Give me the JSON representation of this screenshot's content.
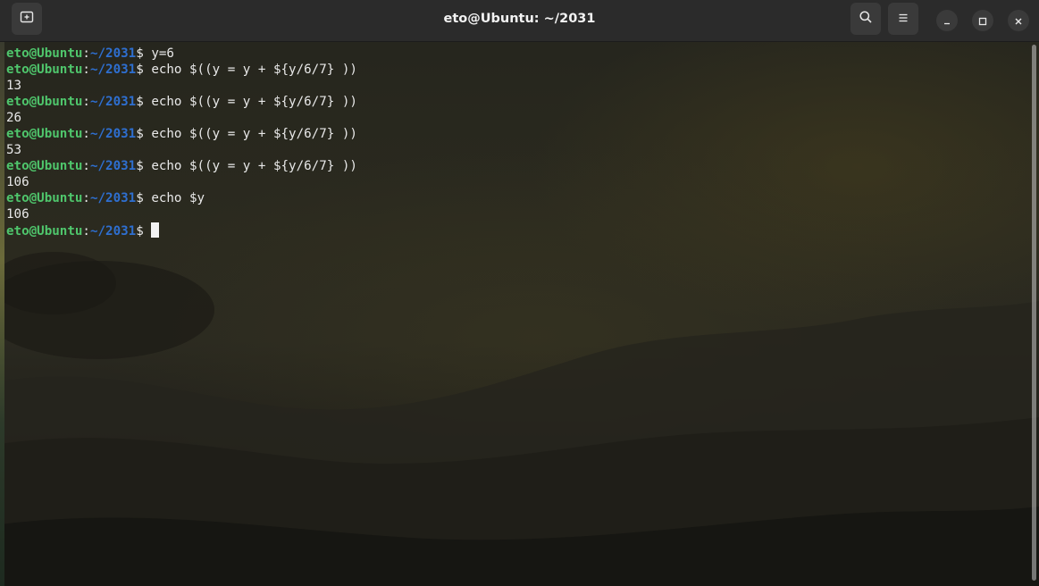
{
  "window": {
    "title": "eto@Ubuntu: ~/2031"
  },
  "prompt": {
    "user_host": "eto@Ubuntu",
    "colon": ":",
    "path": "~/2031",
    "dollar": "$ "
  },
  "lines": [
    {
      "type": "cmd",
      "text": "y=6"
    },
    {
      "type": "cmd",
      "text": "echo $((y = y + ${y/6/7} ))"
    },
    {
      "type": "out",
      "text": "13"
    },
    {
      "type": "cmd",
      "text": "echo $((y = y + ${y/6/7} ))"
    },
    {
      "type": "out",
      "text": "26"
    },
    {
      "type": "cmd",
      "text": "echo $((y = y + ${y/6/7} ))"
    },
    {
      "type": "out",
      "text": "53"
    },
    {
      "type": "cmd",
      "text": "echo $((y = y + ${y/6/7} ))"
    },
    {
      "type": "out",
      "text": "106"
    },
    {
      "type": "cmd",
      "text": "echo $y"
    },
    {
      "type": "out",
      "text": "106"
    },
    {
      "type": "cmd",
      "text": ""
    }
  ],
  "icons": {
    "new_tab": "new-tab-icon",
    "search": "search-icon",
    "menu": "hamburger-menu-icon",
    "minimize": "minimize-icon",
    "maximize": "maximize-icon",
    "close": "close-icon"
  },
  "colors": {
    "prompt_user": "#4fc66c",
    "prompt_path": "#2e6fd0",
    "text": "#e8e8e8",
    "headerbar": "#2b2b2b"
  }
}
